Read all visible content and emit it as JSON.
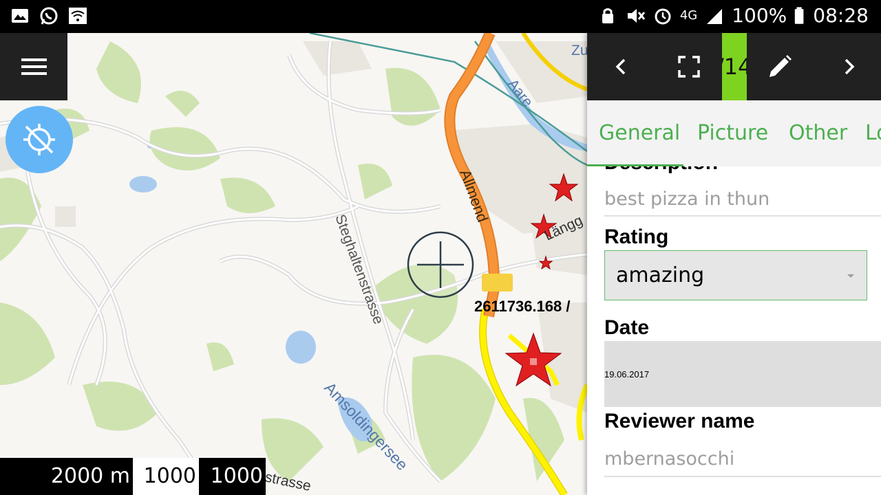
{
  "status_bar": {
    "battery": "100%",
    "time": "08:28",
    "network": "4G",
    "left_icons": [
      "gallery-icon",
      "whatsapp-icon",
      "wifi-icon"
    ],
    "right_icons": [
      "lock-icon",
      "mute-icon",
      "vibrate-icon",
      "alarm-icon",
      "signal-icon",
      "battery-icon"
    ]
  },
  "map": {
    "labels": {
      "road_allmend": "Allmend",
      "road_steghalten": "Steghaltenstrasse",
      "lake_amsoldingen": "Amsoldingersee",
      "river_aare": "Aare",
      "place_zu": "Zu",
      "road_langg": "Längg",
      "road_strasse": "strasse"
    },
    "coordinate_readout": "2611736.168 /",
    "scale": {
      "segment_1": "2000 m",
      "segment_2": "1000",
      "segment_3": "1000"
    },
    "colors": {
      "background": "#f7f6f3",
      "forest": "#cfe3b0",
      "water": "#a9cbee",
      "highway": "#f7943a",
      "trunk": "#fff200",
      "marker": "#e02020",
      "rail": "#4c9c98"
    }
  },
  "panel": {
    "toolbar": {
      "prev_icon": "chevron-left-icon",
      "fullscreen_icon": "fullscreen-icon",
      "counter": "/14",
      "edit_icon": "pencil-icon",
      "next_icon": "chevron-right-icon",
      "accent": "#7ed321"
    },
    "tabs": [
      {
        "label": "General"
      },
      {
        "label": "Picture"
      },
      {
        "label": "Other"
      },
      {
        "label": "Lo"
      }
    ],
    "form": {
      "description_label": "Description",
      "description_value": "best pizza in thun",
      "rating_label": "Rating",
      "rating_value": "amazing",
      "date_label": "Date",
      "date_value": "19.06.2017",
      "reviewer_label": "Reviewer name",
      "reviewer_value": "mbernasocchi"
    }
  }
}
